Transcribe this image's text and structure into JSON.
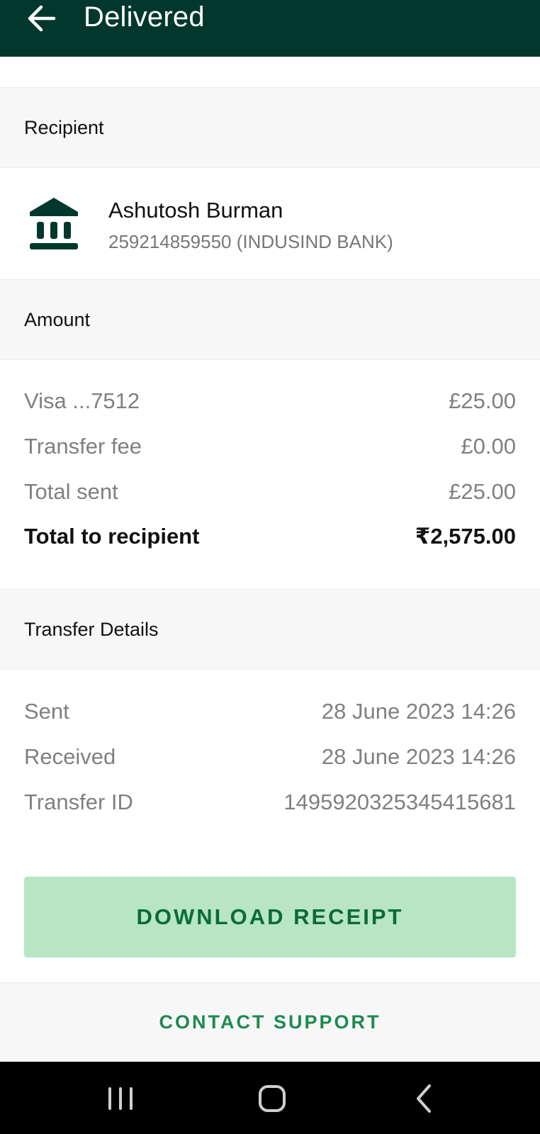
{
  "header": {
    "title": "Delivered",
    "back_icon": "arrow-left-icon",
    "background": "#02382c"
  },
  "recipient_section": {
    "heading": "Recipient",
    "icon": "bank-icon",
    "name": "Ashutosh Burman",
    "account": "259214859550 (INDUSIND BANK)"
  },
  "amount_section": {
    "heading": "Amount",
    "rows": [
      {
        "label": "Visa ...7512",
        "value": "£25.00"
      },
      {
        "label": "Transfer fee",
        "value": "£0.00"
      },
      {
        "label": "Total sent",
        "value": "£25.00"
      },
      {
        "label": "Total to recipient",
        "value": "₹2,575.00"
      }
    ]
  },
  "transfer_section": {
    "heading": "Transfer Details",
    "rows": [
      {
        "label": "Sent",
        "value": "28 June 2023 14:26"
      },
      {
        "label": "Received",
        "value": "28 June 2023 14:26"
      },
      {
        "label": "Transfer ID",
        "value": "1495920325345415681"
      }
    ]
  },
  "actions": {
    "download_label": "DOWNLOAD RECEIPT",
    "contact_label": "CONTACT SUPPORT",
    "download_bg": "#b8e6c4",
    "accent": "#0b6b3a"
  },
  "system_nav": {
    "recents_icon": "recents-icon",
    "home_icon": "home-icon",
    "back_icon": "back-chevron-icon"
  }
}
